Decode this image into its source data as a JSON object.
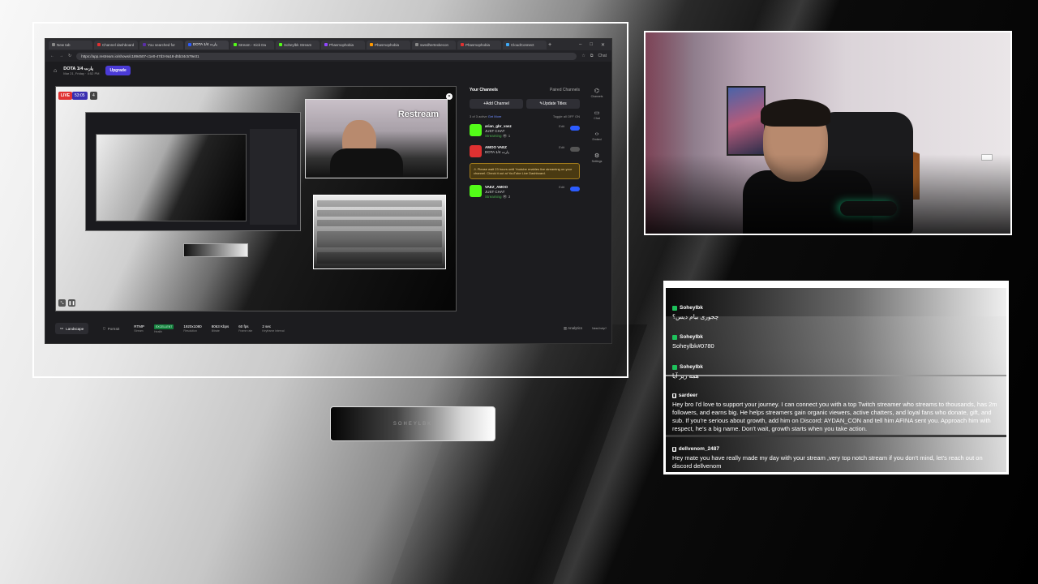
{
  "browser": {
    "tabs": [
      {
        "label": "New tab",
        "color": "#888888"
      },
      {
        "label": "Channel dashboard",
        "color": "#e03131"
      },
      {
        "label": "You searched for",
        "color": "#5a2ea6"
      },
      {
        "label": "DOTA پارت 1/4",
        "color": "#2c5cff",
        "active": true
      },
      {
        "label": "Stream - Kick Da",
        "color": "#53fc18"
      },
      {
        "label": "Soheylbk Stream",
        "color": "#53fc18"
      },
      {
        "label": "Phasmophobia",
        "color": "#9146ff"
      },
      {
        "label": "Phasmophobia",
        "color": "#ff9900"
      },
      {
        "label": "swedhertexkecon",
        "color": "#888888"
      },
      {
        "label": "Phasmophobia",
        "color": "#e03131"
      },
      {
        "label": "CloudConnect",
        "color": "#3fa9f5"
      }
    ],
    "url": "https://app.restream.io/shows/c1894507-c1e0-47d3-9a18-d5b34c579e31",
    "chat_label": "Chat"
  },
  "app": {
    "title": "DOTA پارت 1/4",
    "date": "Mar 21, Friday · 4:52 PM",
    "upgrade_label": "Upgrade"
  },
  "preview": {
    "live_label": "LIVE",
    "timer": "53:05",
    "viewers": "4",
    "watermark": "Restream"
  },
  "channels": {
    "title": "Your Channels",
    "paired": "Paired Channels",
    "add_label": "Add Channel",
    "update_label": "Update Titles",
    "active_count": "3 of 3 active",
    "see_more": "Get More",
    "toggle_all": "Toggle all",
    "toggle_off": "OFF",
    "toggle_on": "ON",
    "edit_label": "Edit",
    "items": [
      {
        "name": "arian_gbr_vasz",
        "title": "JUST CHAT",
        "status": "Streaming",
        "viewers": "1",
        "enabled": true
      },
      {
        "name": "AMOO VAEZ",
        "title": "DOTA پارت 1/4",
        "status": "",
        "viewers": "",
        "enabled": false
      },
      {
        "name": "VAEZ_AMOO",
        "title": "JUST CHAT",
        "status": "Streaming",
        "viewers": "3",
        "enabled": true
      }
    ],
    "warning": "Please wait 23 hours until Youtube enables live streaming on your channel. Check it out at YouTube Live Dashboard."
  },
  "rail": [
    {
      "icon": "channels-icon",
      "label": "Channels"
    },
    {
      "icon": "chat-icon",
      "label": "Chat"
    },
    {
      "icon": "embed-icon",
      "label": "Embed"
    },
    {
      "icon": "settings-icon",
      "label": "Settings"
    }
  ],
  "bottom": {
    "landscape": "Landscape",
    "portrait": "Portrait",
    "protocol": "RTMP",
    "protocol_sub": "Stream",
    "health": "EXCELLENT",
    "health_label": "Health",
    "resolution": "1920x1080",
    "resolution_label": "Resolution",
    "bitrate": "8063 Kbps",
    "bitrate_label": "Bitrate",
    "fps": "60 fps",
    "fps_label": "Frame rate",
    "keyframe": "2 sec",
    "keyframe_label": "Keyframe interval",
    "analytics": "Analytics",
    "need_help": "Need help?"
  },
  "pill_label": "SOHEYLBK",
  "chat": [
    {
      "user": "Soheylbk",
      "platform": "kick",
      "text": "چجوری بیام دیس؟"
    },
    {
      "user": "Soheylbk",
      "platform": "kick",
      "text": "Soheylbk#0780"
    },
    {
      "user": "Soheylbk",
      "platform": "kick",
      "text": "همه زیر آیا"
    },
    {
      "user": "sardeer",
      "platform": "twitch",
      "text": "Hey bro I'd love to support your journey. I can connect you with a top Twitch streamer who streams to thousands, has 2m followers, and earns big. He helps streamers gain organic viewers, active chatters, and loyal fans who donate, gift, and sub. If you're serious about growth, add him on Discord: AYDAN_CON and tell him AFINA sent you. Approach him with respect, he's a big name. Don't wait, growth starts when you take action."
    },
    {
      "user": "dellvenom_2487",
      "platform": "twitch",
      "text": "Hey mate you have really made my day with your stream ,very top notch stream if you don't mind, let's reach out on discord dellvenom"
    }
  ]
}
